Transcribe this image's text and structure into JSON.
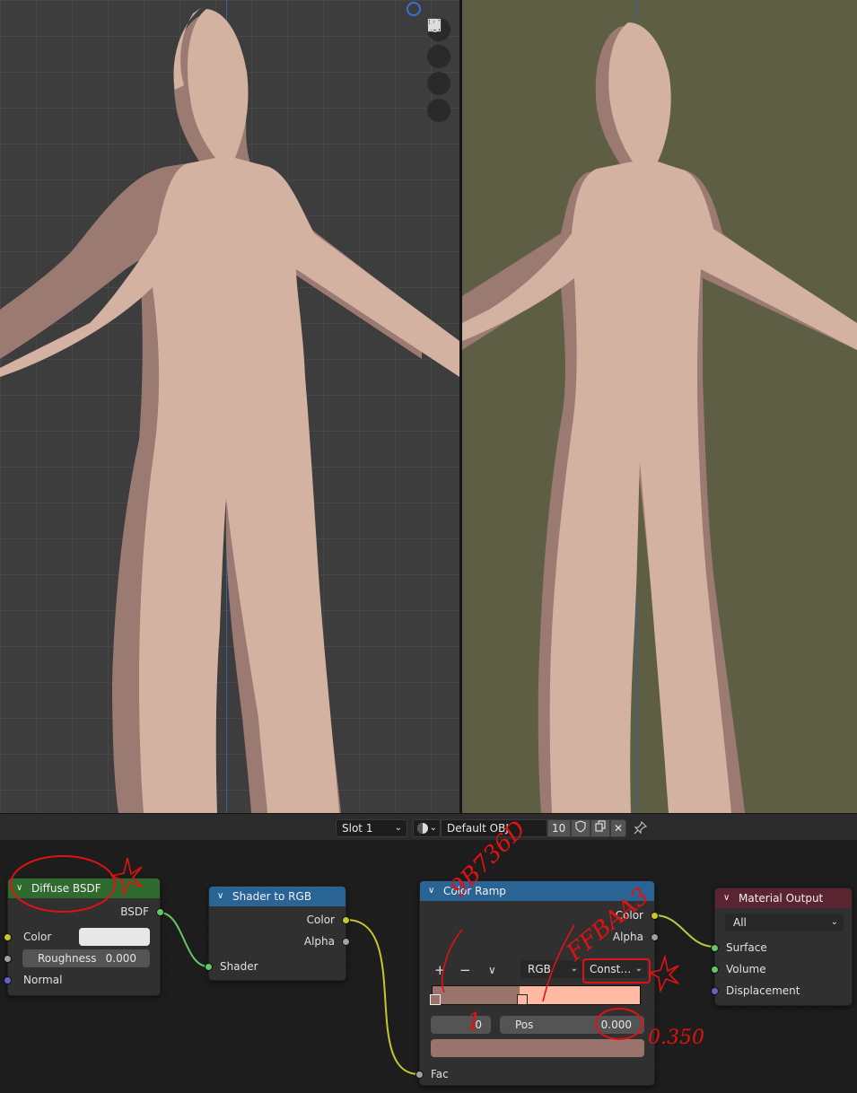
{
  "header": {
    "slot_label": "Slot 1",
    "material_name": "Default OBJ",
    "user_count": "10"
  },
  "nodes": {
    "diffuse": {
      "title": "Diffuse BSDF",
      "output": "BSDF",
      "color_label": "Color",
      "color_value": "#e8e8e8",
      "roughness_label": "Roughness",
      "roughness_value": "0.000",
      "normal_label": "Normal",
      "header_color": "#2f6a2f"
    },
    "shader_to_rgb": {
      "title": "Shader to RGB",
      "out_color": "Color",
      "out_alpha": "Alpha",
      "in_shader": "Shader",
      "header_color": "#2a6495"
    },
    "color_ramp": {
      "title": "Color Ramp",
      "out_color": "Color",
      "out_alpha": "Alpha",
      "add_label": "+",
      "remove_label": "−",
      "color_mode": "RGB",
      "interpolation": "Const…",
      "stop_index": "0",
      "pos_label": "Pos",
      "pos_value": "0.000",
      "in_fac": "Fac",
      "stop_color_1": "#9b736d",
      "stop_color_2": "#ffbaa3",
      "header_color": "#2a6495"
    },
    "material_output": {
      "title": "Material Output",
      "target": "All",
      "in_surface": "Surface",
      "in_volume": "Volume",
      "in_displacement": "Displacement",
      "header_color": "#5a2530"
    }
  },
  "annotations": {
    "dark_hex": "9B736D",
    "light_hex": "FFBAA3",
    "stop_note": "1",
    "pos_note": "0.350"
  },
  "colors": {
    "skin_light": "#d4b2a2",
    "skin_shadow": "#9b7a72",
    "viewport_left_bg": "#3d3d3d",
    "viewport_right_bg": "#5e5e45",
    "annotation_red": "#e01212"
  }
}
